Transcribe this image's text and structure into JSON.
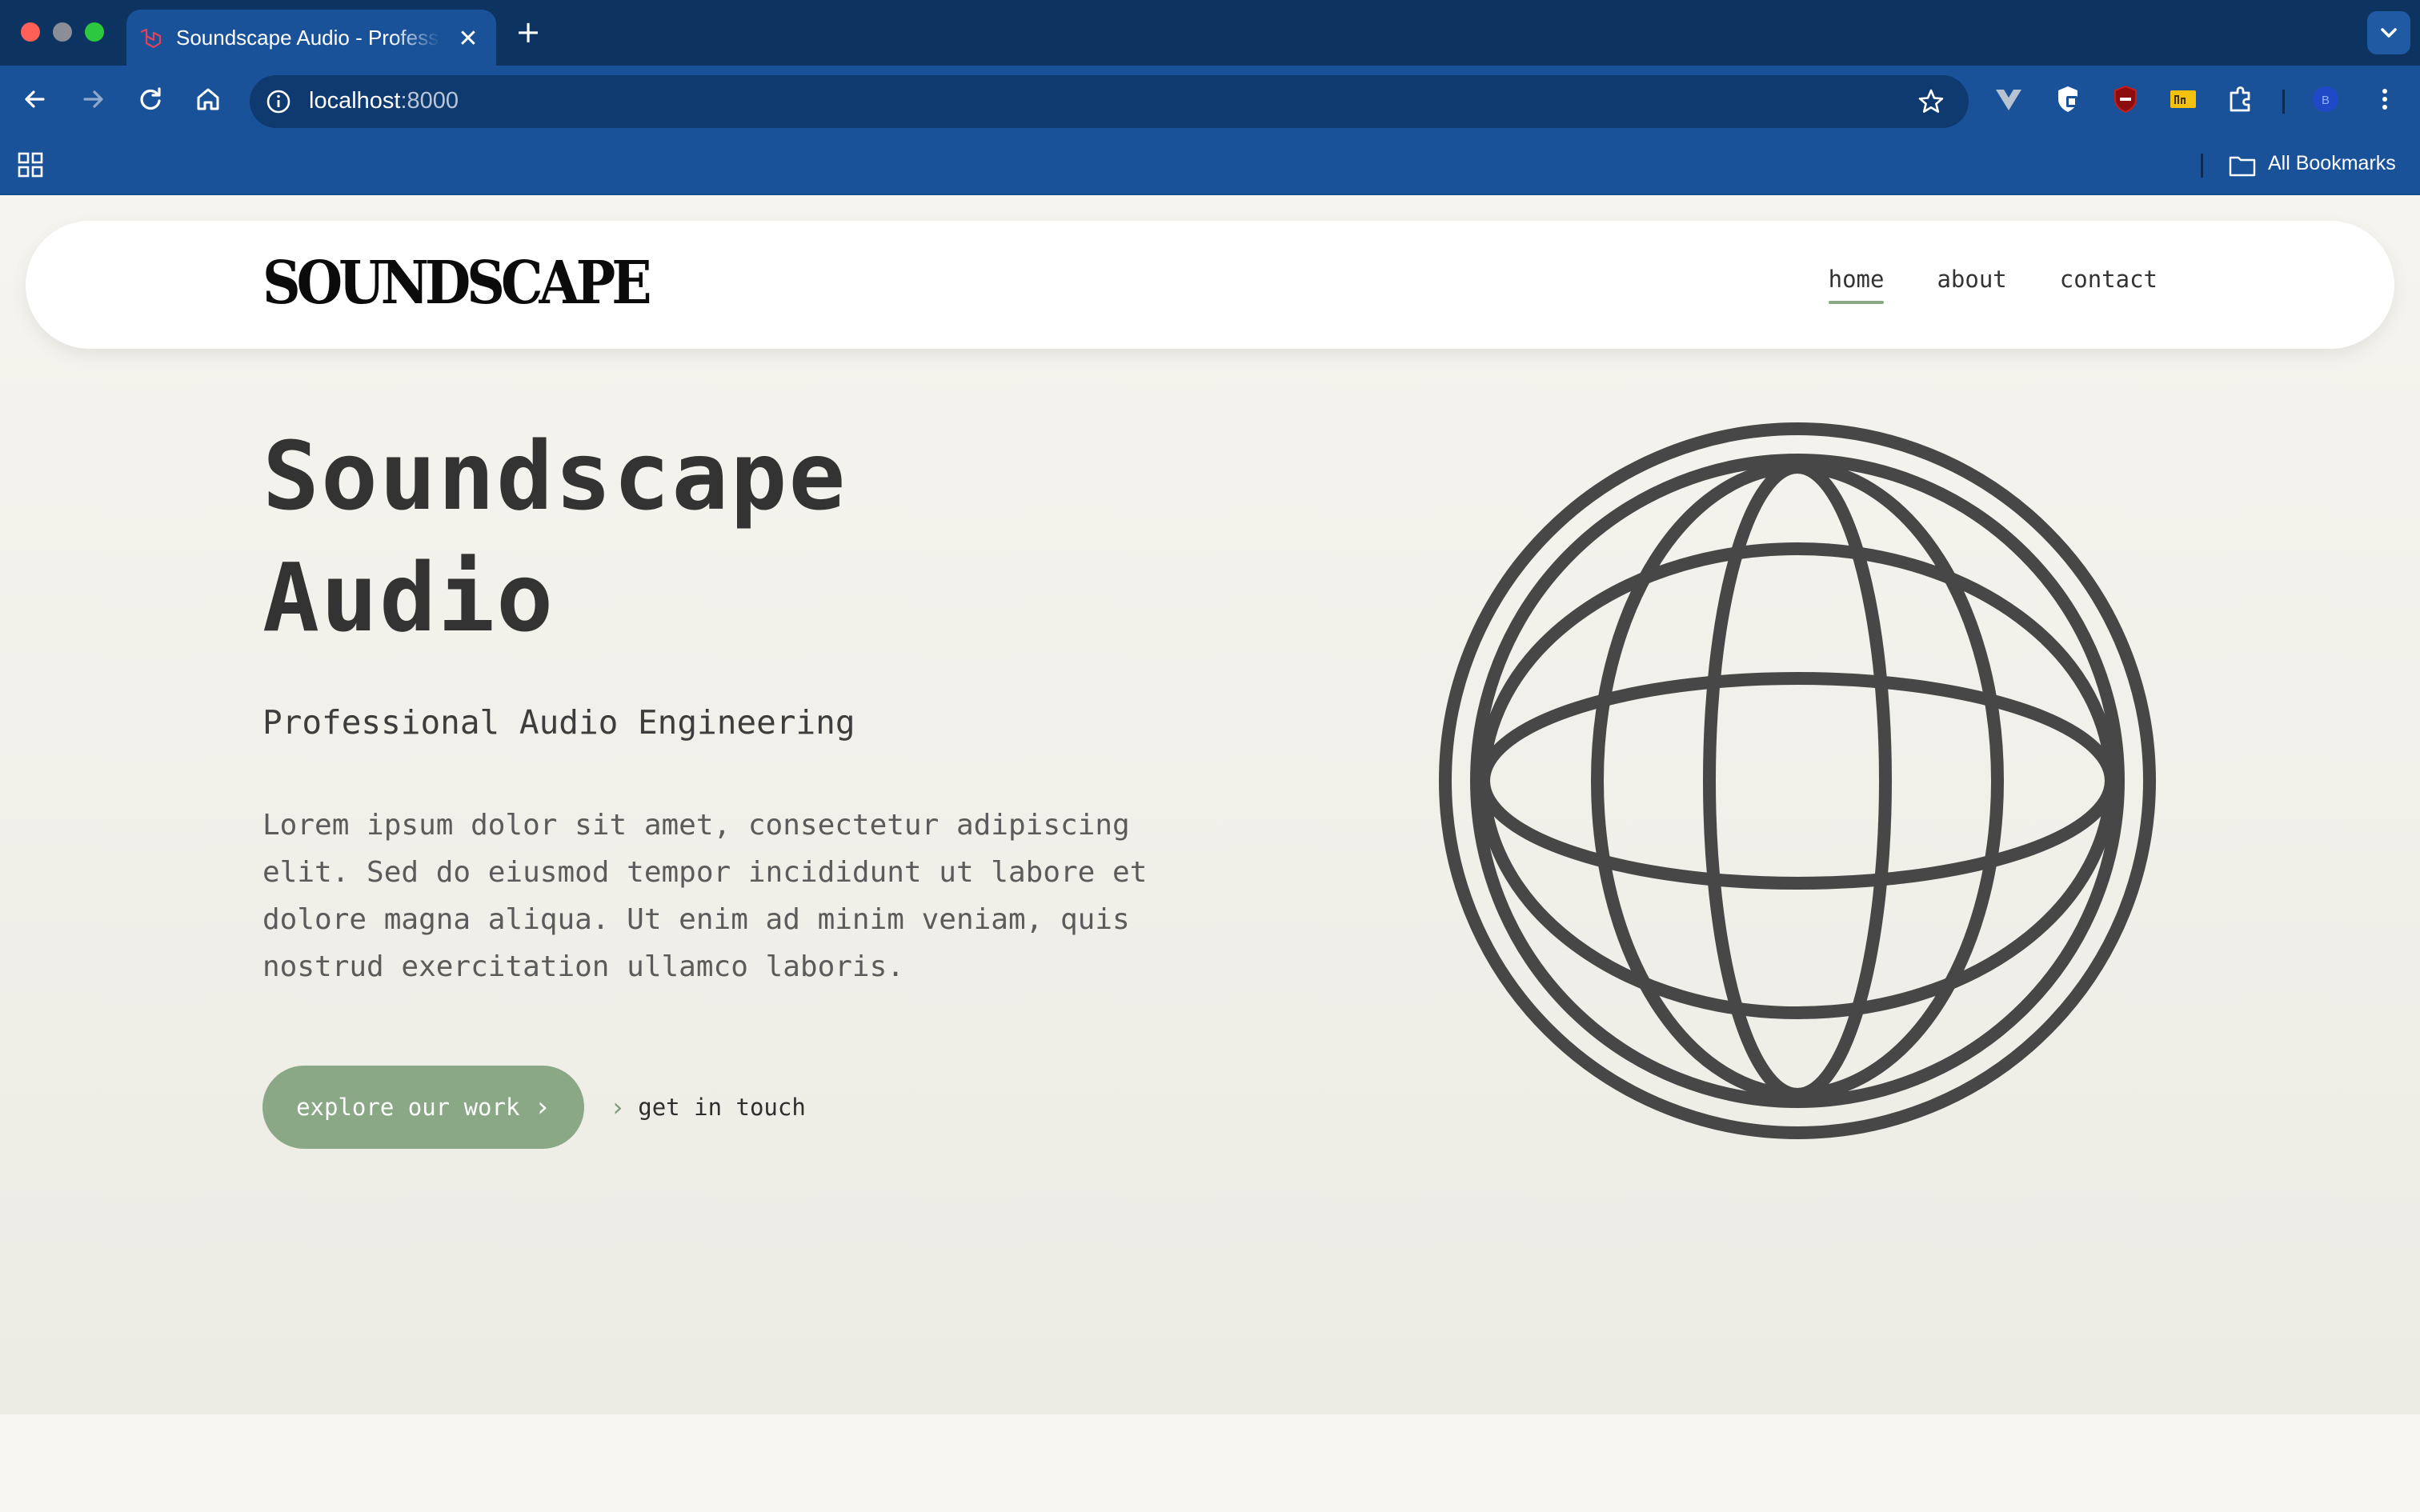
{
  "browser": {
    "tab_title": "Soundscape Audio - Professional Audio Engineering",
    "tab_close": "✕",
    "new_tab": "+",
    "url_host": "localhost",
    "url_port": ":8000",
    "bookmarks_label": "All Bookmarks",
    "profile_initial": "B"
  },
  "site": {
    "logo": "SOUNDSCAPE",
    "nav": [
      {
        "label": "home",
        "active": true
      },
      {
        "label": "about",
        "active": false
      },
      {
        "label": "contact",
        "active": false
      }
    ]
  },
  "hero": {
    "title_line1": "Soundscape",
    "title_line2": "Audio",
    "subtitle": "Professional Audio Engineering",
    "body": "Lorem ipsum dolor sit amet, consectetur adipiscing elit. Sed do eiusmod tempor incididunt ut labore et dolore magna aliqua. Ut enim ad minim veniam, quis nostrud exercitation ullamco laboris.",
    "primary_cta": "explore our work",
    "secondary_cta": "get in touch",
    "chevron": "›"
  },
  "colors": {
    "chrome_dark": "#0d3461",
    "chrome": "#1a5299",
    "accent_green": "#8aa886",
    "text_dark": "#333333",
    "globe_stroke": "#474747"
  },
  "icons": [
    "back-arrow-icon",
    "forward-arrow-icon",
    "reload-icon",
    "home-icon",
    "site-info-icon",
    "bookmark-star-icon",
    "apps-grid-icon",
    "folder-icon",
    "globe-icon",
    "chevron-right-icon"
  ]
}
